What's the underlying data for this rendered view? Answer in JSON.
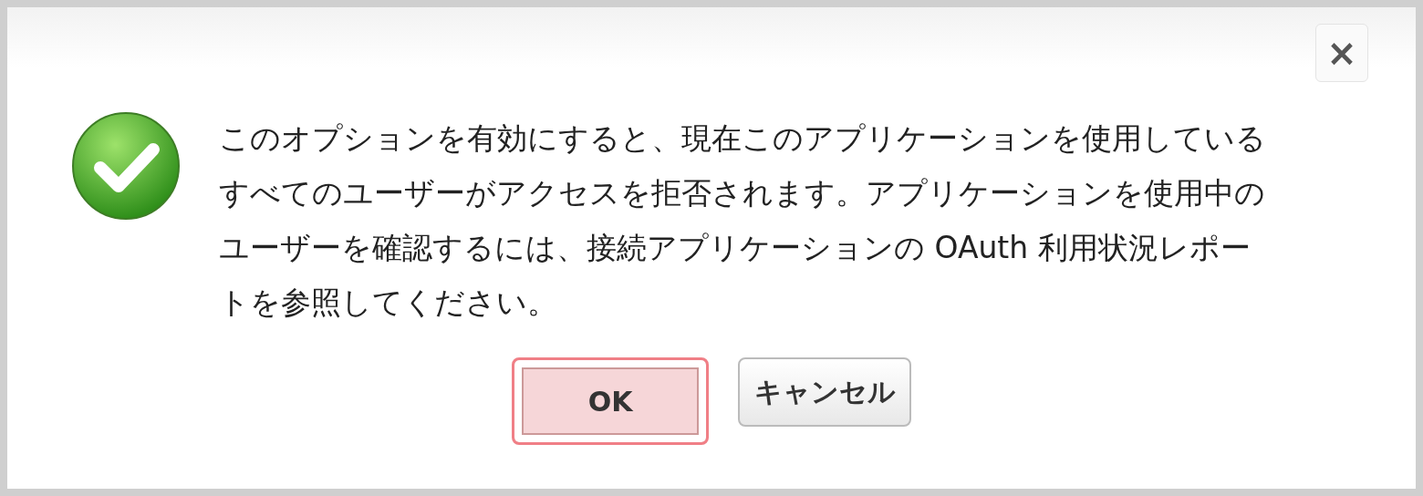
{
  "dialog": {
    "message": "このオプションを有効にすると、現在このアプリケーションを使用しているすべてのユーザーがアクセスを拒否されます。アプリケーションを使用中のユーザーを確認するには、接続アプリケーションの OAuth 利用状況レポートを参照してください。",
    "close_label": "×",
    "buttons": [
      {
        "label": "OK",
        "highlighted": true
      },
      {
        "label": "キャンセル",
        "highlighted": false
      }
    ]
  }
}
